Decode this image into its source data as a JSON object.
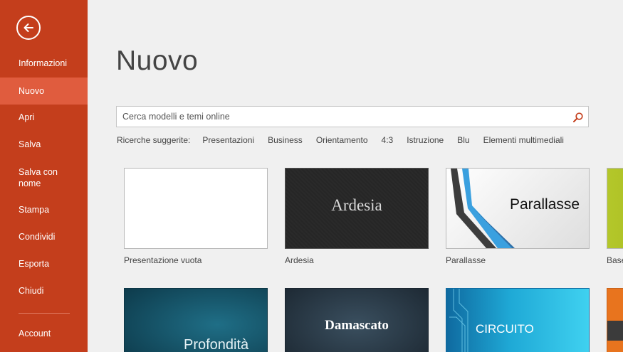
{
  "sidebar": {
    "back_icon": "back-arrow-icon",
    "items": [
      {
        "label": "Informazioni"
      },
      {
        "label": "Nuovo"
      },
      {
        "label": "Apri"
      },
      {
        "label": "Salva"
      },
      {
        "label": "Salva con nome"
      },
      {
        "label": "Stampa"
      },
      {
        "label": "Condividi"
      },
      {
        "label": "Esporta"
      },
      {
        "label": "Chiudi"
      },
      {
        "label": "Account"
      }
    ],
    "active": "Nuovo",
    "colors": {
      "background": "#c43e1c",
      "active": "#e05c3e"
    }
  },
  "main": {
    "title": "Nuovo",
    "search": {
      "placeholder": "Cerca modelli e temi online",
      "value": "",
      "icon": "search-icon"
    },
    "suggested": {
      "label": "Ricerche suggerite:",
      "links": [
        "Presentazioni",
        "Business",
        "Orientamento",
        "4:3",
        "Istruzione",
        "Blu",
        "Elementi multimediali"
      ]
    },
    "templates": [
      {
        "label": "Presentazione vuota"
      },
      {
        "label": "Ardesia",
        "thumb_text": "Ardesia"
      },
      {
        "label": "Parallasse",
        "thumb_text": "Parallasse"
      },
      {
        "label": "Base"
      },
      {
        "label": "",
        "thumb_text": "Profondità"
      },
      {
        "label": "",
        "thumb_text": "Damascato"
      },
      {
        "label": "",
        "thumb_text": "CIRCUITO"
      },
      {
        "label": ""
      }
    ]
  }
}
